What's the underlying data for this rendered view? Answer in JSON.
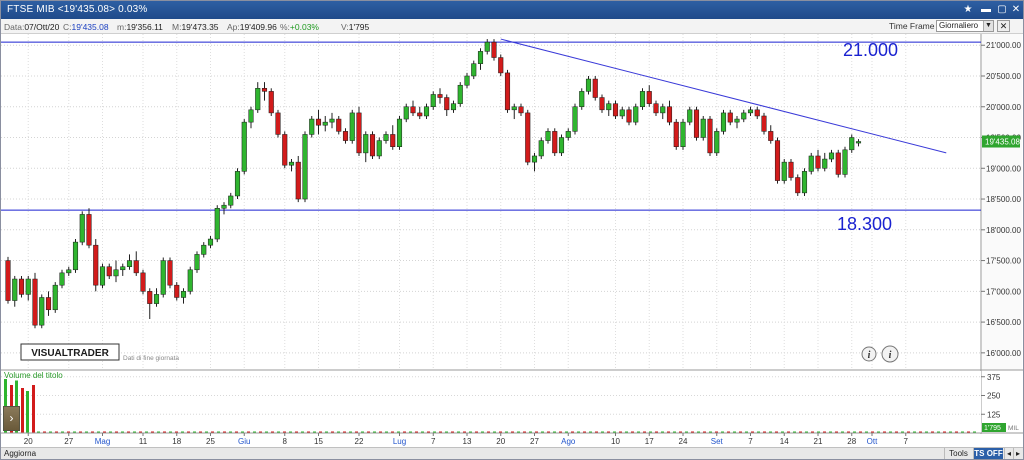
{
  "window": {
    "title": "FTSE MIB <19'435.08> 0.03%"
  },
  "info": {
    "date_label": "Data:",
    "date": "07/Ott/20",
    "close_label": "C:",
    "close": "19'435.08",
    "min_label": "m:",
    "min": "19'356.11",
    "max_label": "M:",
    "max": "19'473.35",
    "open_label": "Ap:",
    "open": "19'409.96",
    "pct_label": "%:",
    "pct": "+0.03%",
    "volume_label": "V:",
    "volume": "1'795"
  },
  "timeframe": {
    "label": "Time Frame",
    "selected": "Giornaliero"
  },
  "chart_data": {
    "type": "candlestick",
    "title": "",
    "ylim": [
      15900,
      21150
    ],
    "y_ticks": [
      "21'000.00",
      "20'500.00",
      "20'000.00",
      "19'500.00",
      "19'000.00",
      "18'500.00",
      "18'000.00",
      "17'500.00",
      "17'000.00",
      "16'500.00",
      "16'000.00"
    ],
    "y_tick_values": [
      21000,
      20500,
      20000,
      19500,
      19000,
      18500,
      18000,
      17500,
      17000,
      16500,
      16000
    ],
    "x_ticks": [
      "20",
      "27",
      "Mag",
      "11",
      "18",
      "25",
      "Giu",
      "8",
      "15",
      "22",
      "Lug",
      "7",
      "13",
      "20",
      "27",
      "Ago",
      "10",
      "17",
      "24",
      "Set",
      "7",
      "14",
      "21",
      "28",
      "Ott",
      "7"
    ],
    "x_tick_month": [
      false,
      false,
      true,
      false,
      false,
      false,
      true,
      false,
      false,
      false,
      true,
      false,
      false,
      false,
      false,
      true,
      false,
      false,
      false,
      true,
      false,
      false,
      false,
      false,
      true,
      false
    ],
    "x_tick_index": [
      3,
      9,
      14,
      20,
      25,
      30,
      35,
      41,
      46,
      52,
      58,
      63,
      68,
      73,
      78,
      83,
      90,
      95,
      100,
      105,
      110,
      115,
      120,
      125,
      128,
      133
    ],
    "last_price_label": "19'435.08",
    "levels": [
      {
        "value": 21050,
        "label": "21.000",
        "color": "#1a22d0"
      },
      {
        "value": 18320,
        "label": "18.300",
        "color": "#1a22d0"
      }
    ],
    "trendline": {
      "from": [
        73,
        21100
      ],
      "to": [
        139,
        19250
      ],
      "color": "#3a3ad8"
    },
    "candles": [
      [
        17500,
        17560,
        16800,
        16850
      ],
      [
        16850,
        17250,
        16750,
        17200
      ],
      [
        17200,
        17250,
        16900,
        16950
      ],
      [
        16950,
        17250,
        16850,
        17200
      ],
      [
        17200,
        17300,
        16400,
        16450
      ],
      [
        16450,
        16950,
        16400,
        16900
      ],
      [
        16900,
        17000,
        16600,
        16700
      ],
      [
        16700,
        17150,
        16650,
        17100
      ],
      [
        17100,
        17350,
        17050,
        17300
      ],
      [
        17300,
        17400,
        17250,
        17350
      ],
      [
        17350,
        17850,
        17300,
        17800
      ],
      [
        17800,
        18300,
        17750,
        18250
      ],
      [
        18250,
        18350,
        17700,
        17750
      ],
      [
        17750,
        17850,
        17000,
        17100
      ],
      [
        17100,
        17450,
        17050,
        17400
      ],
      [
        17400,
        17450,
        17200,
        17250
      ],
      [
        17250,
        17500,
        17150,
        17350
      ],
      [
        17350,
        17450,
        17250,
        17400
      ],
      [
        17400,
        17600,
        17350,
        17500
      ],
      [
        17500,
        17650,
        17250,
        17300
      ],
      [
        17300,
        17350,
        16950,
        17000
      ],
      [
        17000,
        17050,
        16550,
        16800
      ],
      [
        16800,
        17050,
        16750,
        16950
      ],
      [
        16950,
        17550,
        16900,
        17500
      ],
      [
        17500,
        17550,
        17050,
        17100
      ],
      [
        17100,
        17150,
        16850,
        16900
      ],
      [
        16900,
        17050,
        16800,
        17000
      ],
      [
        17000,
        17400,
        16950,
        17350
      ],
      [
        17350,
        17650,
        17300,
        17600
      ],
      [
        17600,
        17800,
        17550,
        17750
      ],
      [
        17750,
        17900,
        17700,
        17850
      ],
      [
        17850,
        18400,
        17800,
        18350
      ],
      [
        18350,
        18450,
        18250,
        18400
      ],
      [
        18400,
        18600,
        18350,
        18550
      ],
      [
        18550,
        19000,
        18500,
        18950
      ],
      [
        18950,
        19800,
        18900,
        19750
      ],
      [
        19750,
        20000,
        19650,
        19950
      ],
      [
        19950,
        20400,
        19900,
        20300
      ],
      [
        20300,
        20400,
        20100,
        20250
      ],
      [
        20250,
        20300,
        19850,
        19900
      ],
      [
        19900,
        19950,
        19500,
        19550
      ],
      [
        19550,
        19600,
        19000,
        19050
      ],
      [
        19050,
        19150,
        18950,
        19100
      ],
      [
        19100,
        19200,
        18450,
        18500
      ],
      [
        18500,
        19600,
        18450,
        19550
      ],
      [
        19550,
        19850,
        19500,
        19800
      ],
      [
        19800,
        19950,
        19550,
        19700
      ],
      [
        19700,
        19850,
        19600,
        19750
      ],
      [
        19750,
        19900,
        19650,
        19800
      ],
      [
        19800,
        19850,
        19550,
        19600
      ],
      [
        19600,
        19650,
        19400,
        19450
      ],
      [
        19450,
        19950,
        19400,
        19900
      ],
      [
        19900,
        20000,
        19200,
        19250
      ],
      [
        19250,
        19600,
        19100,
        19550
      ],
      [
        19550,
        19600,
        19150,
        19200
      ],
      [
        19200,
        19500,
        19150,
        19450
      ],
      [
        19450,
        19600,
        19400,
        19550
      ],
      [
        19550,
        19700,
        19300,
        19350
      ],
      [
        19350,
        19850,
        19300,
        19800
      ],
      [
        19800,
        20050,
        19750,
        20000
      ],
      [
        20000,
        20100,
        19850,
        19900
      ],
      [
        19900,
        20000,
        19800,
        19850
      ],
      [
        19850,
        20050,
        19800,
        20000
      ],
      [
        20000,
        20250,
        19950,
        20200
      ],
      [
        20200,
        20300,
        20050,
        20150
      ],
      [
        20150,
        20200,
        19850,
        19950
      ],
      [
        19950,
        20100,
        19900,
        20050
      ],
      [
        20050,
        20400,
        20000,
        20350
      ],
      [
        20350,
        20550,
        20300,
        20500
      ],
      [
        20500,
        20750,
        20450,
        20700
      ],
      [
        20700,
        20950,
        20600,
        20900
      ],
      [
        20900,
        21100,
        20850,
        21050
      ],
      [
        21050,
        21100,
        20750,
        20800
      ],
      [
        20800,
        20850,
        20500,
        20550
      ],
      [
        20550,
        20600,
        19900,
        19950
      ],
      [
        19950,
        20050,
        19800,
        20000
      ],
      [
        20000,
        20050,
        19850,
        19900
      ],
      [
        19900,
        19950,
        19050,
        19100
      ],
      [
        19100,
        19250,
        18950,
        19200
      ],
      [
        19200,
        19500,
        19150,
        19450
      ],
      [
        19450,
        19650,
        19400,
        19600
      ],
      [
        19600,
        19650,
        19200,
        19250
      ],
      [
        19250,
        19550,
        19200,
        19500
      ],
      [
        19500,
        19650,
        19450,
        19600
      ],
      [
        19600,
        20050,
        19550,
        20000
      ],
      [
        20000,
        20300,
        19950,
        20250
      ],
      [
        20250,
        20500,
        20200,
        20450
      ],
      [
        20450,
        20500,
        20100,
        20150
      ],
      [
        20150,
        20200,
        19900,
        19950
      ],
      [
        19950,
        20100,
        19850,
        20050
      ],
      [
        20050,
        20100,
        19800,
        19850
      ],
      [
        19850,
        20000,
        19800,
        19950
      ],
      [
        19950,
        20000,
        19700,
        19750
      ],
      [
        19750,
        20050,
        19700,
        20000
      ],
      [
        20000,
        20300,
        19950,
        20250
      ],
      [
        20250,
        20350,
        20000,
        20050
      ],
      [
        20050,
        20100,
        19850,
        19900
      ],
      [
        19900,
        20050,
        19800,
        20000
      ],
      [
        20000,
        20100,
        19700,
        19750
      ],
      [
        19750,
        19800,
        19300,
        19350
      ],
      [
        19350,
        19800,
        19300,
        19750
      ],
      [
        19750,
        20000,
        19700,
        19950
      ],
      [
        19950,
        20000,
        19450,
        19500
      ],
      [
        19500,
        19850,
        19450,
        19800
      ],
      [
        19800,
        19850,
        19200,
        19250
      ],
      [
        19250,
        19650,
        19200,
        19600
      ],
      [
        19600,
        19950,
        19550,
        19900
      ],
      [
        19900,
        19950,
        19700,
        19750
      ],
      [
        19750,
        19850,
        19650,
        19800
      ],
      [
        19800,
        19950,
        19750,
        19900
      ],
      [
        19900,
        20000,
        19850,
        19950
      ],
      [
        19950,
        20000,
        19800,
        19850
      ],
      [
        19850,
        19900,
        19550,
        19600
      ],
      [
        19600,
        19700,
        19400,
        19450
      ],
      [
        19450,
        19500,
        18750,
        18800
      ],
      [
        18800,
        19150,
        18750,
        19100
      ],
      [
        19100,
        19150,
        18800,
        18850
      ],
      [
        18850,
        18900,
        18550,
        18600
      ],
      [
        18600,
        19000,
        18550,
        18950
      ],
      [
        18950,
        19250,
        18900,
        19200
      ],
      [
        19200,
        19300,
        18950,
        19000
      ],
      [
        19000,
        19250,
        18950,
        19150
      ],
      [
        19150,
        19300,
        19100,
        19250
      ],
      [
        19250,
        19300,
        18850,
        18900
      ],
      [
        18900,
        19350,
        18850,
        19300
      ],
      [
        19300,
        19550,
        19250,
        19500
      ],
      [
        19409.96,
        19473.35,
        19356.11,
        19435.08
      ]
    ]
  },
  "brand": {
    "logo": "VISUALTRADER",
    "subtitle": "Dati di fine giornata"
  },
  "volume_panel": {
    "title": "Volume del titolo",
    "y_ticks": [
      "375",
      "250",
      "125"
    ],
    "y_tick_values": [
      375,
      250,
      125
    ],
    "last_label": "1'795",
    "unit": "MIL"
  },
  "bottom": {
    "refresh": "Aggiorna",
    "tools": "Tools",
    "ts": "TS OFF"
  },
  "colors": {
    "up": "#2fb52f",
    "down": "#d21b1b",
    "accent": "#2b5fa8"
  }
}
